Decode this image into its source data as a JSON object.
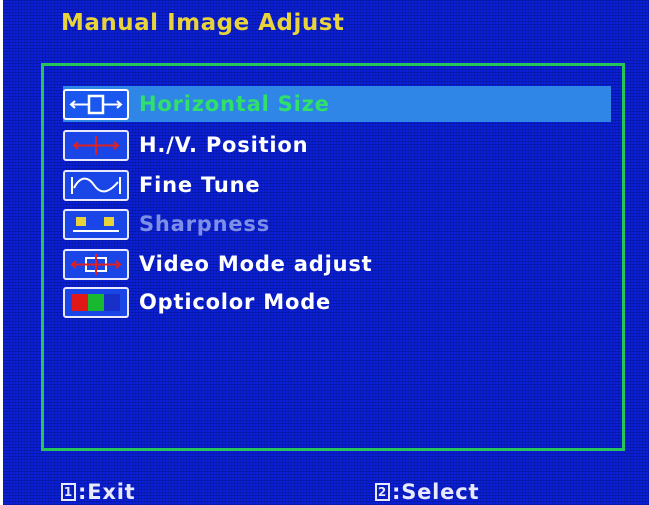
{
  "osd": {
    "title": "Manual Image Adjust",
    "menu_items": [
      {
        "label": "Horizontal Size",
        "icon": "horizontal-size-icon",
        "state": "selected"
      },
      {
        "label": "H./V. Position",
        "icon": "position-icon",
        "state": "enabled"
      },
      {
        "label": "Fine Tune",
        "icon": "fine-tune-icon",
        "state": "enabled"
      },
      {
        "label": "Sharpness",
        "icon": "sharpness-icon",
        "state": "disabled"
      },
      {
        "label": "Video Mode adjust",
        "icon": "video-mode-icon",
        "state": "enabled"
      },
      {
        "label": "Opticolor Mode",
        "icon": "opticolor-icon",
        "state": "enabled"
      }
    ],
    "footer": {
      "exit_key": "1",
      "exit_label": ":Exit",
      "select_key": "2",
      "select_label": ":Select"
    }
  },
  "colors": {
    "background": "#0a1fd6",
    "title": "#e8d33a",
    "frame": "#27c45a",
    "selection_bar": "#2f86e6",
    "selected_text": "#2fe06a",
    "disabled_text": "#7d8fe8"
  }
}
